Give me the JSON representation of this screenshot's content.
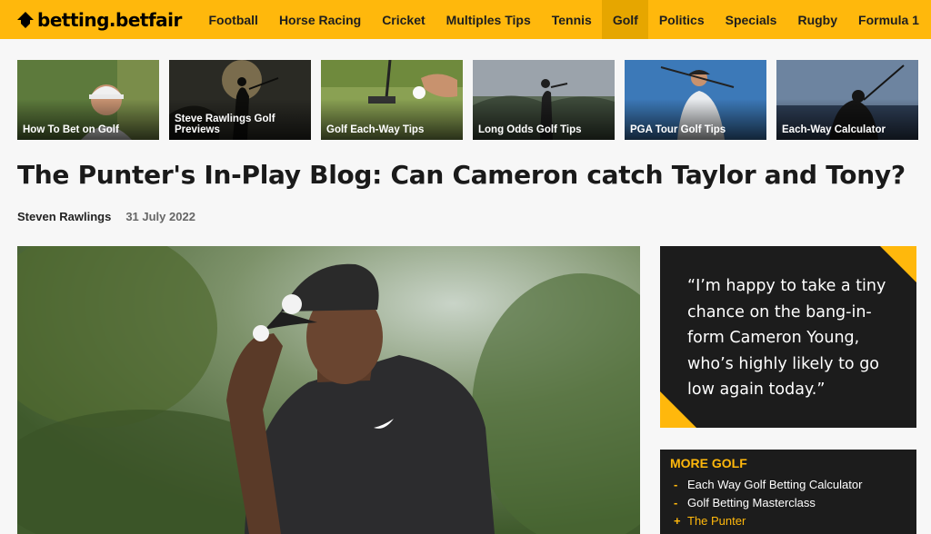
{
  "header": {
    "logo_text": "betting.betfair",
    "nav": [
      {
        "label": "Football",
        "active": false
      },
      {
        "label": "Horse Racing",
        "active": false
      },
      {
        "label": "Cricket",
        "active": false
      },
      {
        "label": "Multiples Tips",
        "active": false
      },
      {
        "label": "Tennis",
        "active": false
      },
      {
        "label": "Golf",
        "active": true
      },
      {
        "label": "Politics",
        "active": false
      },
      {
        "label": "Specials",
        "active": false
      },
      {
        "label": "Rugby",
        "active": false
      },
      {
        "label": "Formula 1",
        "active": false
      }
    ]
  },
  "thumbnails": [
    {
      "label": "How To Bet on Golf"
    },
    {
      "label": "Steve Rawlings Golf Previews"
    },
    {
      "label": "Golf Each-Way Tips"
    },
    {
      "label": "Long Odds Golf Tips"
    },
    {
      "label": "PGA Tour Golf Tips"
    },
    {
      "label": "Each-Way Calculator"
    }
  ],
  "article": {
    "title": "The Punter's In-Play Blog: Can Cameron catch Taylor and Tony?",
    "author": "Steven Rawlings",
    "date": "31 July 2022"
  },
  "quote": {
    "text": "“I’m happy to take a tiny chance on the bang-in-form Cameron Young, who’s highly likely to go low again today.”"
  },
  "more_golf": {
    "heading": "MORE GOLF",
    "items": [
      {
        "label": "Each Way Golf Betting Calculator",
        "bullet": "-"
      },
      {
        "label": "Golf Betting Masterclass",
        "bullet": "-"
      },
      {
        "label": "The Punter",
        "bullet": "+"
      }
    ]
  },
  "colors": {
    "brand_yellow": "#ffb80c",
    "dark_panel": "#1c1c1c"
  },
  "icons": {
    "logo": "betfair-arrow-logo-icon"
  }
}
